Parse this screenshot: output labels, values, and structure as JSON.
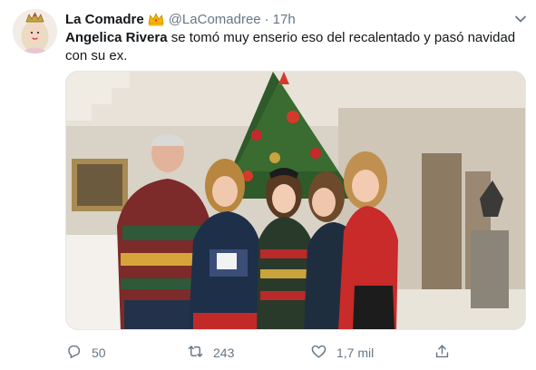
{
  "tweet": {
    "author": {
      "display_name": "La Comadre",
      "handle": "@LaComadree",
      "badge_icon": "crown-icon",
      "separator": "·",
      "time": "17h"
    },
    "text": {
      "mention": "Angelica Rivera",
      "body": " se tomó muy enserio eso del recalentado y pasó navidad con su ex."
    },
    "media": {
      "type": "photo",
      "description_icon": "family-christmas-photo"
    },
    "actions": {
      "reply_count": "50",
      "retweet_count": "243",
      "like_count": "1,7 mil"
    },
    "colors": {
      "text_primary": "#14171a",
      "text_secondary": "#657786",
      "border": "#e1e8ed",
      "crown": "#f4b400"
    }
  }
}
